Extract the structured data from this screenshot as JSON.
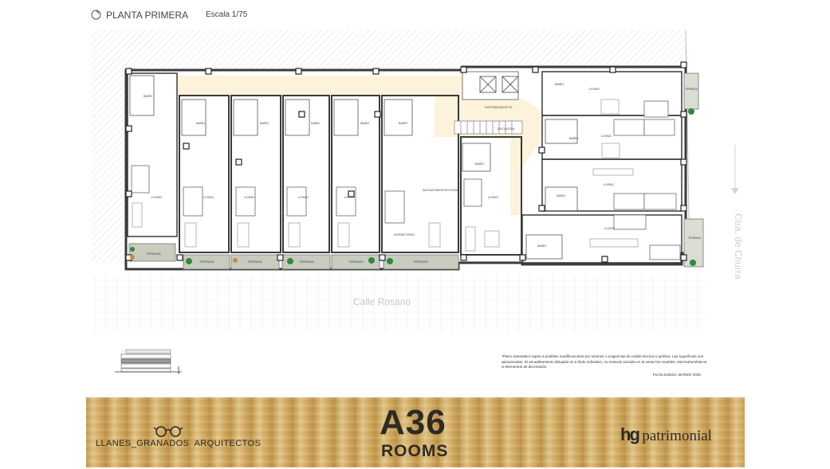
{
  "header": {
    "title": "PLANTA PRIMERA",
    "scale": "Escala 1/75"
  },
  "plan": {
    "street_bottom": "Calle Rosario",
    "street_right": "Ctra. de Churra",
    "room_labels": {
      "bano": "BAÑO",
      "living": "LIVING",
      "terraza": "TERRAZA",
      "dormitorio": "DORMITORIO",
      "salon": "SALÓN/COMEDOR/COCINA",
      "distribuidor": "DISTRIBUIDOR P1",
      "escalera": "ESCALERA"
    },
    "colors": {
      "corridor": "#fdf3dc",
      "terrace": "#c8ccbf",
      "wall": "#3a3a3a",
      "plant": "#2e8b3a"
    }
  },
  "notes": {
    "disclaimer_lines": [
      "*Plano orientativo sujeto a posibles modificaciones por razones o exigencias de índole técnica o jurídica. Las superficies son",
      "aproximadas. El amueblamiento dibujado es a título indicativo, no estando incluido en la venta los muebles, electrodomésticos",
      "ni elementos de decoración."
    ],
    "edition_date": "Fecha Edición: MARZO 2026"
  },
  "banner": {
    "architect": "LLANES_GRANADOS  ARQUITECTOS",
    "project_line1": "A36",
    "project_line2": "ROOMS",
    "brand_mark": "hg",
    "brand_name": "patrimonial",
    "wood_color": "#d4ad60"
  }
}
